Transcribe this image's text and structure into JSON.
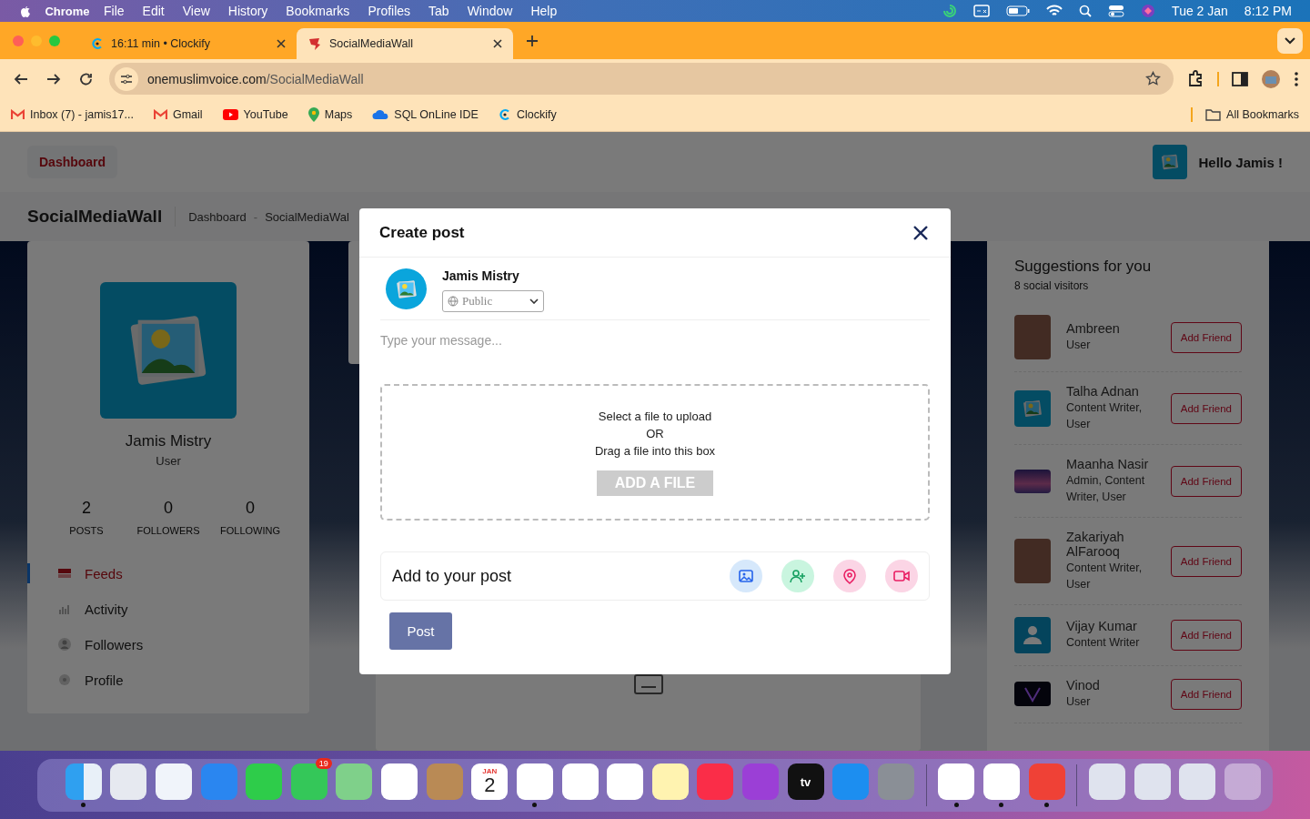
{
  "menubar": {
    "app": "Chrome",
    "menus": [
      "File",
      "Edit",
      "View",
      "History",
      "Bookmarks",
      "Profiles",
      "Tab",
      "Window",
      "Help"
    ],
    "date": "Tue 2 Jan",
    "time": "8:12 PM"
  },
  "browser": {
    "tabs": [
      {
        "title": "16:11 min • Clockify",
        "kind": "clockify",
        "selected": false
      },
      {
        "title": "SocialMediaWall",
        "kind": "smw",
        "selected": true
      }
    ],
    "url_host": "onemuslimvoice.com",
    "url_path": "/SocialMediaWall",
    "bookmarks": [
      {
        "label": "Inbox (7) - jamis17...",
        "kind": "mail"
      },
      {
        "label": "Gmail",
        "kind": "mail"
      },
      {
        "label": "YouTube",
        "kind": "video"
      },
      {
        "label": "Maps",
        "kind": "pin"
      },
      {
        "label": "SQL OnLine IDE",
        "kind": "cloud"
      },
      {
        "label": "Clockify",
        "kind": "clockify"
      }
    ],
    "all_bookmarks": "All Bookmarks"
  },
  "page": {
    "header_button": "Dashboard",
    "greeting": "Hello Jamis !",
    "title": "SocialMediaWall",
    "breadcrumb": [
      "Dashboard",
      "SocialMediaWal"
    ],
    "breadcrumb_separator": "-",
    "profile": {
      "name": "Jamis Mistry",
      "role": "User",
      "stats": [
        {
          "value": "2",
          "label": "POSTS"
        },
        {
          "value": "0",
          "label": "FOLLOWERS"
        },
        {
          "value": "0",
          "label": "FOLLOWING"
        }
      ],
      "nav": [
        {
          "label": "Feeds",
          "kind": "feeds",
          "selected": true
        },
        {
          "label": "Activity",
          "kind": "activity",
          "selected": false
        },
        {
          "label": "Followers",
          "kind": "followers",
          "selected": false
        },
        {
          "label": "Profile",
          "kind": "profile",
          "selected": false
        }
      ]
    },
    "suggestions": {
      "title": "Suggestions for you",
      "subtitle": "8 social visitors",
      "people": [
        {
          "name": "Ambreen",
          "roles": "User",
          "kind": "photo",
          "button": "Add Friend"
        },
        {
          "name": "Talha Adnan",
          "roles": "Content Writer, User",
          "kind": "image",
          "button": "Add Friend"
        },
        {
          "name": "Maanha Nasir",
          "roles": "Admin, Content Writer, User",
          "kind": "landscape",
          "button": "Add Friend"
        },
        {
          "name": "Zakariyah AlFarooq",
          "roles": "Content Writer, User",
          "kind": "photo",
          "button": "Add Friend"
        },
        {
          "name": "Vijay Kumar",
          "roles": "Content Writer",
          "kind": "person",
          "button": "Add Friend"
        },
        {
          "name": "Vinod",
          "roles": "User",
          "kind": "logo",
          "button": "Add Friend"
        }
      ]
    }
  },
  "modal": {
    "title": "Create post",
    "author": "Jamis Mistry",
    "audience": "Public",
    "placeholder": "Type your message...",
    "upload_lines": [
      "Select a file to upload",
      "OR",
      "Drag a file into this box"
    ],
    "add_file": "ADD A FILE",
    "add_file_disabled": true,
    "add_to_post": "Add to your post",
    "actions": [
      {
        "kind": "image"
      },
      {
        "kind": "tag"
      },
      {
        "kind": "location"
      },
      {
        "kind": "video"
      }
    ],
    "post": "Post"
  },
  "dock": {
    "apps": [
      {
        "kind": "finder",
        "running": true
      },
      {
        "kind": "launchpad",
        "running": false
      },
      {
        "kind": "safari",
        "running": false
      },
      {
        "kind": "mail",
        "running": false
      },
      {
        "kind": "facetime",
        "running": false
      },
      {
        "kind": "messages",
        "running": false,
        "badge": "19"
      },
      {
        "kind": "maps",
        "running": false
      },
      {
        "kind": "photos",
        "running": false
      },
      {
        "kind": "contacts",
        "running": false
      },
      {
        "kind": "calendar",
        "running": false,
        "month": "JAN",
        "day": "2"
      },
      {
        "kind": "chrome",
        "running": true
      },
      {
        "kind": "slides",
        "running": false
      },
      {
        "kind": "reminders",
        "running": false
      },
      {
        "kind": "notes",
        "running": false
      },
      {
        "kind": "music",
        "running": false
      },
      {
        "kind": "podcasts",
        "running": false
      },
      {
        "kind": "tv",
        "running": false,
        "label": "tv"
      },
      {
        "kind": "appstore",
        "running": false
      },
      {
        "kind": "settings",
        "running": false
      },
      {
        "kind": "sep"
      },
      {
        "kind": "timer",
        "running": true
      },
      {
        "kind": "teams",
        "running": true
      },
      {
        "kind": "remote",
        "running": true
      },
      {
        "kind": "sep"
      },
      {
        "kind": "window",
        "running": false
      },
      {
        "kind": "window",
        "running": false
      },
      {
        "kind": "window",
        "running": false
      },
      {
        "kind": "trash",
        "running": false
      }
    ]
  }
}
